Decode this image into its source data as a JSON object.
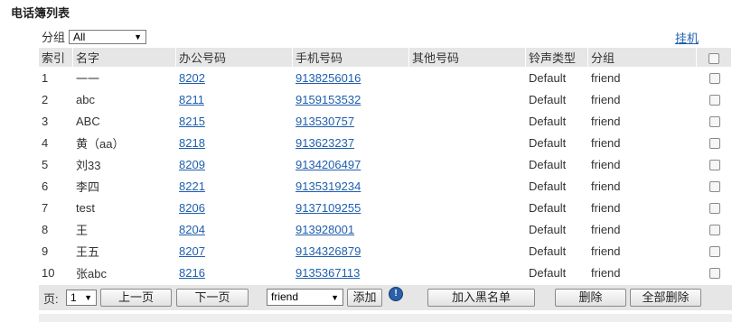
{
  "page": {
    "title": "电话簿列表"
  },
  "filter": {
    "label": "分组",
    "selected": "All"
  },
  "hangup": {
    "label": "挂机"
  },
  "table": {
    "headers": [
      "索引",
      "名字",
      "办公号码",
      "手机号码",
      "其他号码",
      "铃声类型",
      "分组"
    ],
    "rows": [
      {
        "index": "1",
        "name": "一一",
        "office": "8202",
        "mobile": "9138256016",
        "other": "",
        "ring": "Default",
        "group": "friend"
      },
      {
        "index": "2",
        "name": "abc",
        "office": "8211",
        "mobile": "9159153532",
        "other": "",
        "ring": "Default",
        "group": "friend"
      },
      {
        "index": "3",
        "name": "ABC",
        "office": "8215",
        "mobile": "913530757",
        "other": "",
        "ring": "Default",
        "group": "friend"
      },
      {
        "index": "4",
        "name": "黄（aa）",
        "office": "8218",
        "mobile": "913623237",
        "other": "",
        "ring": "Default",
        "group": "friend"
      },
      {
        "index": "5",
        "name": "刘33",
        "office": "8209",
        "mobile": "9134206497",
        "other": "",
        "ring": "Default",
        "group": "friend"
      },
      {
        "index": "6",
        "name": "李四",
        "office": "8221",
        "mobile": "9135319234",
        "other": "",
        "ring": "Default",
        "group": "friend"
      },
      {
        "index": "7",
        "name": "test",
        "office": "8206",
        "mobile": "9137109255",
        "other": "",
        "ring": "Default",
        "group": "friend"
      },
      {
        "index": "8",
        "name": "王",
        "office": "8204",
        "mobile": "913928001",
        "other": "",
        "ring": "Default",
        "group": "friend"
      },
      {
        "index": "9",
        "name": "王五",
        "office": "8207",
        "mobile": "9134326879",
        "other": "",
        "ring": "Default",
        "group": "friend"
      },
      {
        "index": "10",
        "name": "张abc",
        "office": "8216",
        "mobile": "9135367113",
        "other": "",
        "ring": "Default",
        "group": "friend"
      }
    ]
  },
  "footer": {
    "page_label": "页:",
    "page_selected": "1",
    "prev_label": "上一页",
    "next_label": "下一页",
    "group_selected": "friend",
    "add_label": "添加",
    "info_icon": "info-icon",
    "blacklist_label": "加入黑名单",
    "delete_label": "删除",
    "delete_all_label": "全部删除"
  },
  "colors": {
    "link": "#1f5fae",
    "header_bg": "#e6e6e6",
    "info_icon": "#2b5fa8"
  }
}
